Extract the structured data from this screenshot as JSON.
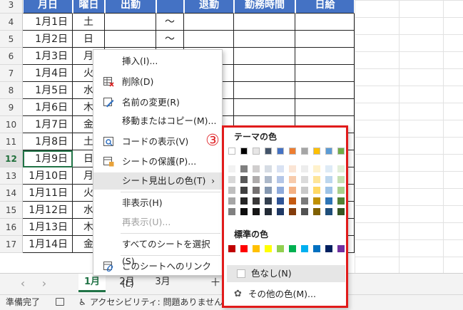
{
  "columns": {
    "date": "月日",
    "day": "曜日",
    "start": "出勤",
    "end": "退勤",
    "hours": "勤務時間",
    "wage": "日給"
  },
  "rows": [
    {
      "num": "3"
    },
    {
      "num": "4",
      "date": "1月1日",
      "day": "土",
      "wave": "～"
    },
    {
      "num": "5",
      "date": "1月2日",
      "day": "日",
      "wave": "～"
    },
    {
      "num": "6",
      "date": "1月3日",
      "day": "月"
    },
    {
      "num": "7",
      "date": "1月4日",
      "day": "火"
    },
    {
      "num": "8",
      "date": "1月5日",
      "day": "水"
    },
    {
      "num": "9",
      "date": "1月6日",
      "day": "木"
    },
    {
      "num": "10",
      "date": "1月7日",
      "day": "金"
    },
    {
      "num": "11",
      "date": "1月8日",
      "day": "土"
    },
    {
      "num": "12",
      "date": "1月9日",
      "day": "日"
    },
    {
      "num": "13",
      "date": "1月10日",
      "day": "月"
    },
    {
      "num": "14",
      "date": "1月11日",
      "day": "火"
    },
    {
      "num": "15",
      "date": "1月12日",
      "day": "水"
    },
    {
      "num": "16",
      "date": "1月13日",
      "day": "木"
    },
    {
      "num": "17",
      "date": "1月14日",
      "day": "金"
    }
  ],
  "context_menu": {
    "insert": "挿入(I)...",
    "delete": "削除(D)",
    "rename": "名前の変更(R)",
    "move_copy": "移動またはコピー(M)...",
    "view_code": "コードの表示(V)",
    "protect": "シートの保護(P)...",
    "tab_color": "シート見出しの色(T)",
    "hide": "非表示(H)",
    "unhide": "再表示(U)...",
    "select_all": "すべてのシートを選択(S)",
    "link": "このシートへのリンク(L)"
  },
  "palette": {
    "theme_title": "テーマの色",
    "standard_title": "標準の色",
    "no_color": "色なし(N)",
    "more_colors": "その他の色(M)...",
    "theme_top": [
      "#ffffff",
      "#000000",
      "#e7e6e6",
      "#44546a",
      "#4472c4",
      "#ed7d31",
      "#a5a5a5",
      "#ffc000",
      "#5b9bd5",
      "#70ad47"
    ],
    "theme_shades": [
      [
        "#f2f2f2",
        "#d9d9d9",
        "#bfbfbf",
        "#a6a6a6",
        "#808080"
      ],
      [
        "#7f7f7f",
        "#595959",
        "#404040",
        "#262626",
        "#0d0d0d"
      ],
      [
        "#d0cece",
        "#aeabab",
        "#757171",
        "#3a3838",
        "#171616"
      ],
      [
        "#d6dce4",
        "#adb9ca",
        "#8497b0",
        "#333f4f",
        "#222a35"
      ],
      [
        "#d9e2f3",
        "#b4c6e7",
        "#8eaadb",
        "#2f5496",
        "#1f3864"
      ],
      [
        "#fbe5d5",
        "#f7cbac",
        "#f4b183",
        "#c55a11",
        "#833c0b"
      ],
      [
        "#ededed",
        "#dbdbdb",
        "#c9c9c9",
        "#7b7b7b",
        "#525252"
      ],
      [
        "#fff2cc",
        "#fee599",
        "#ffd965",
        "#bf9000",
        "#7f6000"
      ],
      [
        "#deebf6",
        "#bdd7ee",
        "#9dc3e6",
        "#2e75b5",
        "#1f4e79"
      ],
      [
        "#e2efd9",
        "#c5e0b3",
        "#a8d08d",
        "#538135",
        "#375623"
      ]
    ],
    "standard": [
      "#c00000",
      "#ff0000",
      "#ffc000",
      "#ffff00",
      "#92d050",
      "#00b050",
      "#00b0f0",
      "#0070c0",
      "#002060",
      "#7030a0"
    ]
  },
  "badge": "③",
  "tabs": [
    "1月",
    "2月",
    "3月"
  ],
  "add_sheet": "＋",
  "status": {
    "ready": "準備完了",
    "accessibility": "アクセシビリティ: 問題ありません"
  },
  "colors": {
    "header_bg": "#4472c4",
    "highlight": "#e11b1b",
    "excel_green": "#217346"
  }
}
